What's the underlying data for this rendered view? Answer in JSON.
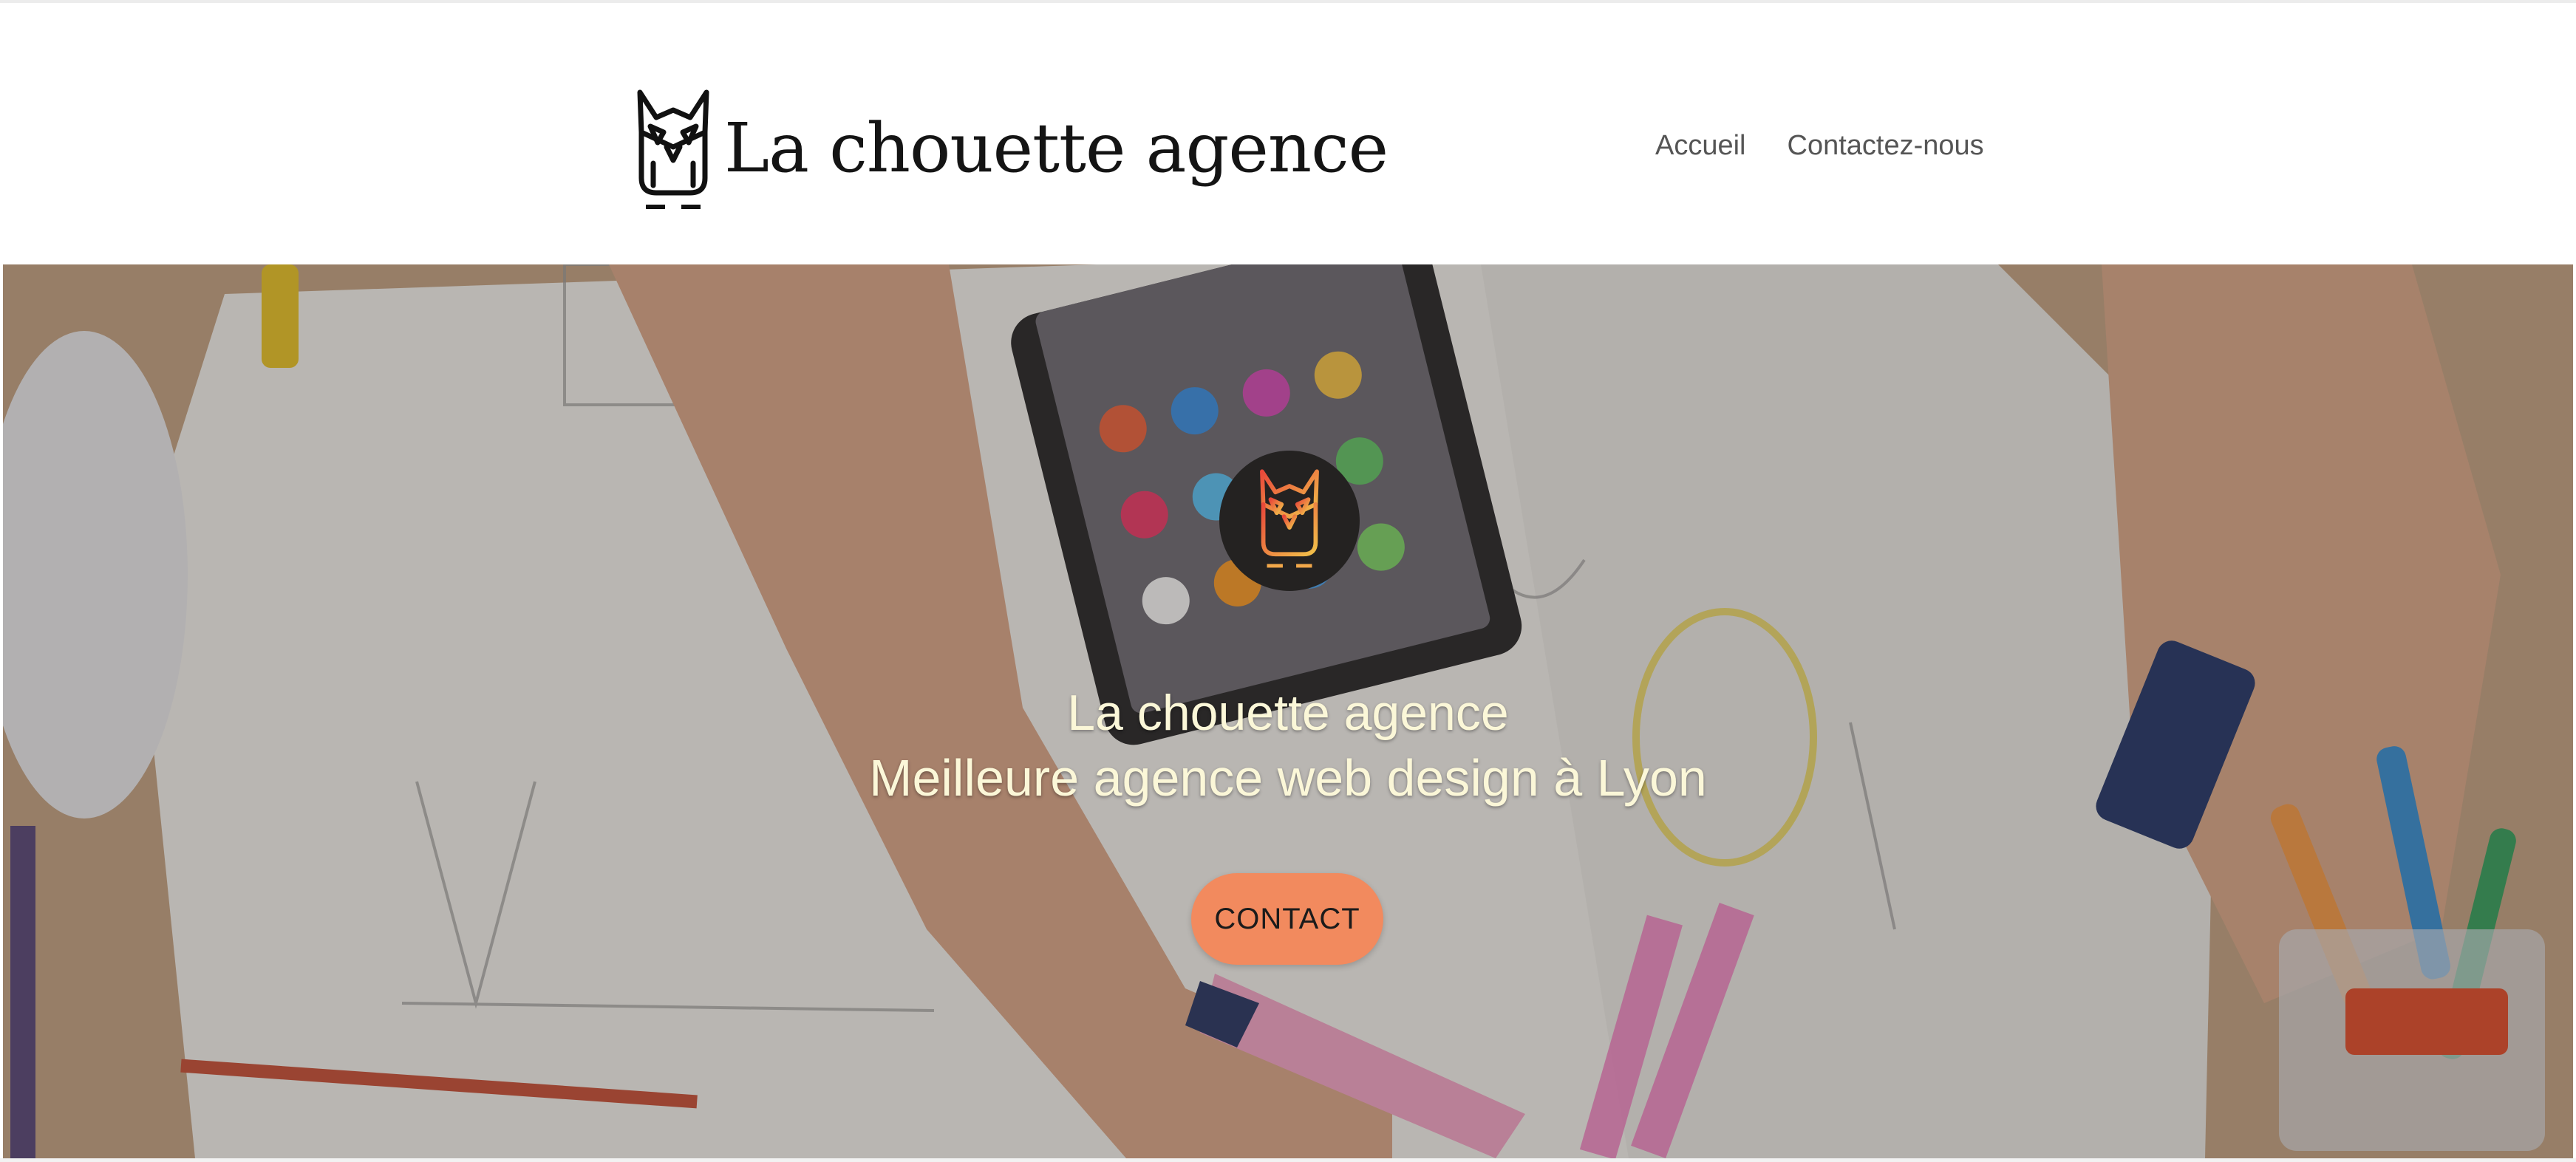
{
  "header": {
    "brand_name": "La chouette agence",
    "logo_icon": "owl-logo-icon",
    "nav": [
      {
        "label": "Accueil"
      },
      {
        "label": "Contactez-nous"
      }
    ]
  },
  "hero": {
    "badge_icon": "owl-badge-icon",
    "title": "La chouette agence",
    "subtitle": "Meilleure agence web design à Lyon",
    "cta_label": "CONTACT",
    "background_image": "desk-workspace-photo"
  },
  "colors": {
    "accent": "#f28a5e",
    "hero_text": "#fbf7d8",
    "nav_text": "#555555",
    "badge_bg": "#242221"
  }
}
